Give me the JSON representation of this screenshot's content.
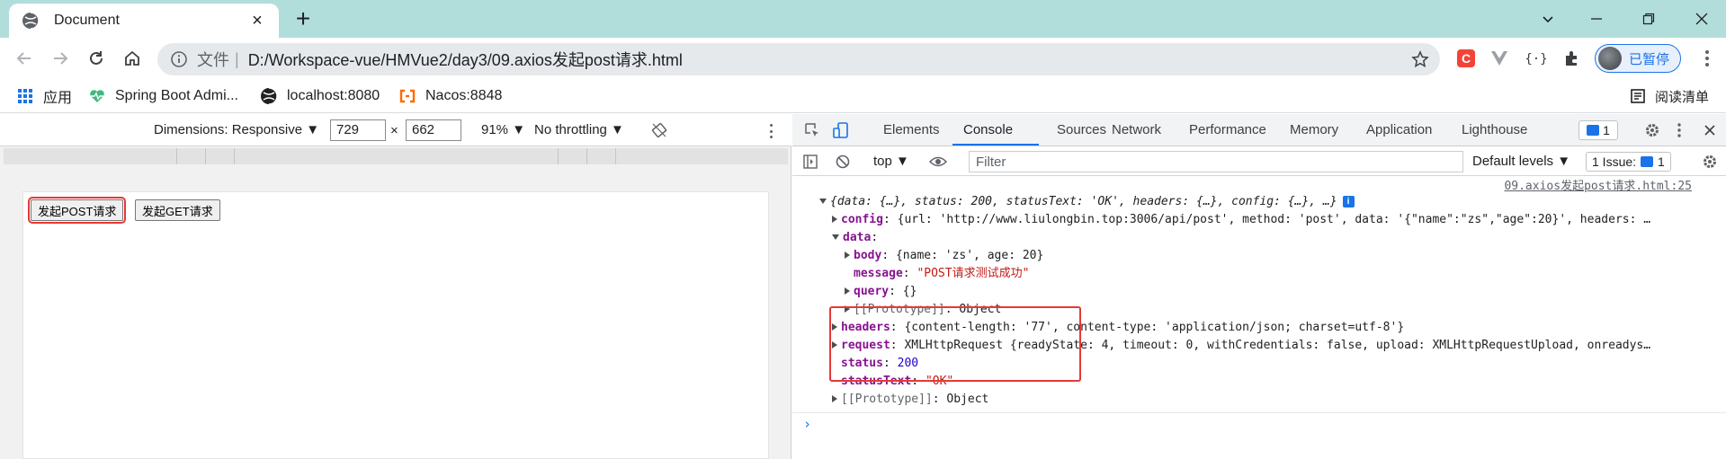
{
  "tab": {
    "title": "Document",
    "favicon": "globe-icon",
    "close": "×",
    "new_tab": "+"
  },
  "toolbar": {
    "scheme": "文件",
    "separator": "|",
    "url": "D:/Workspace-vue/HMVue2/day3/09.axios发起post请求.html",
    "profile_label": "已暂停"
  },
  "bookmarks": [
    {
      "label": "应用",
      "icon": "apps-grid-icon"
    },
    {
      "label": "Spring Boot Admi...",
      "icon": "spring-heartbeat-icon"
    },
    {
      "label": "localhost:8080",
      "icon": "globe-icon"
    },
    {
      "label": "Nacos:8848",
      "icon": "nacos-icon"
    }
  ],
  "reading_list": "阅读清单",
  "device_toolbar": {
    "dimensions": "Dimensions: Responsive ▼",
    "width": "729",
    "times": "×",
    "height": "662",
    "zoom": "91% ▼",
    "throttling": "No throttling ▼"
  },
  "page": {
    "post_button": "发起POST请求",
    "get_button": "发起GET请求"
  },
  "devtools": {
    "tabs": [
      "Elements",
      "Console",
      "Sources",
      "Network",
      "Performance",
      "Memory",
      "Application",
      "Lighthouse"
    ],
    "active_tab": "Console",
    "message_count": "1",
    "context": "top ▼",
    "filter_placeholder": "Filter",
    "levels": "Default levels ▼",
    "issues_label": "1 Issue:",
    "issues_count": "1"
  },
  "console": {
    "source_link": "09.axios发起post请求.html:25",
    "summary": "{data: {…}, status: 200, statusText: 'OK', headers: {…}, config: {…}, …}",
    "info_badge": "i",
    "config_key": "config",
    "config_val": "{url: 'http://www.liulongbin.top:3006/api/post', method: 'post', data: '{\"name\":\"zs\",\"age\":20}', headers: …",
    "data_key": "data",
    "body_key": "body",
    "body_val": "{name: 'zs', age: 20}",
    "message_key": "message",
    "message_val": "\"POST请求测试成功\"",
    "query_key": "query",
    "query_val": "{}",
    "proto_inner_key": "[[Prototype]]",
    "proto_inner_val": "Object",
    "headers_key": "headers",
    "headers_val": "{content-length: '77', content-type: 'application/json; charset=utf-8'}",
    "request_key": "request",
    "request_val": "XMLHttpRequest {readyState: 4, timeout: 0, withCredentials: false, upload: XMLHttpRequestUpload, onreadys…",
    "status_key": "status",
    "status_val": "200",
    "statustext_key": "statusText",
    "statustext_val": "\"OK\"",
    "proto_key": "[[Prototype]]",
    "proto_val": "Object",
    "prompt": "›"
  },
  "colors": {
    "tabstrip": "#b1dedb",
    "accent": "#1a73e8",
    "highlight": "#e53935"
  }
}
